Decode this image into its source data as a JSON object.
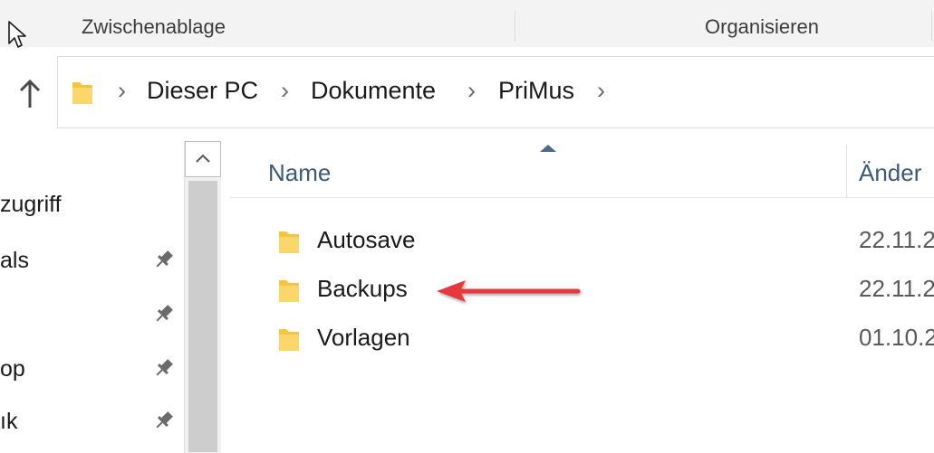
{
  "ribbon": {
    "group_clipboard": "Zwischenablage",
    "group_organize": "Organisieren"
  },
  "address": {
    "crumbs": [
      "Dieser PC",
      "Dokumente",
      "PriMus"
    ]
  },
  "nav": {
    "items": [
      "zugriff",
      "als",
      "",
      "op",
      "ık"
    ]
  },
  "columns": {
    "name": "Name",
    "date": "Änder"
  },
  "files": [
    {
      "name": "Autosave",
      "date": "22.11.2"
    },
    {
      "name": "Backups",
      "date": "22.11.2"
    },
    {
      "name": "Vorlagen",
      "date": "01.10.2"
    }
  ],
  "colors": {
    "folder": "#f5c542",
    "annotation_arrow": "#e8393c",
    "header_text": "#3c5a78"
  },
  "icons": [
    "cursor-icon",
    "up-arrow-icon",
    "folder-icon",
    "chevron-right-icon",
    "pin-icon",
    "scroll-up-icon",
    "sort-up-icon",
    "red-arrow-annotation"
  ]
}
